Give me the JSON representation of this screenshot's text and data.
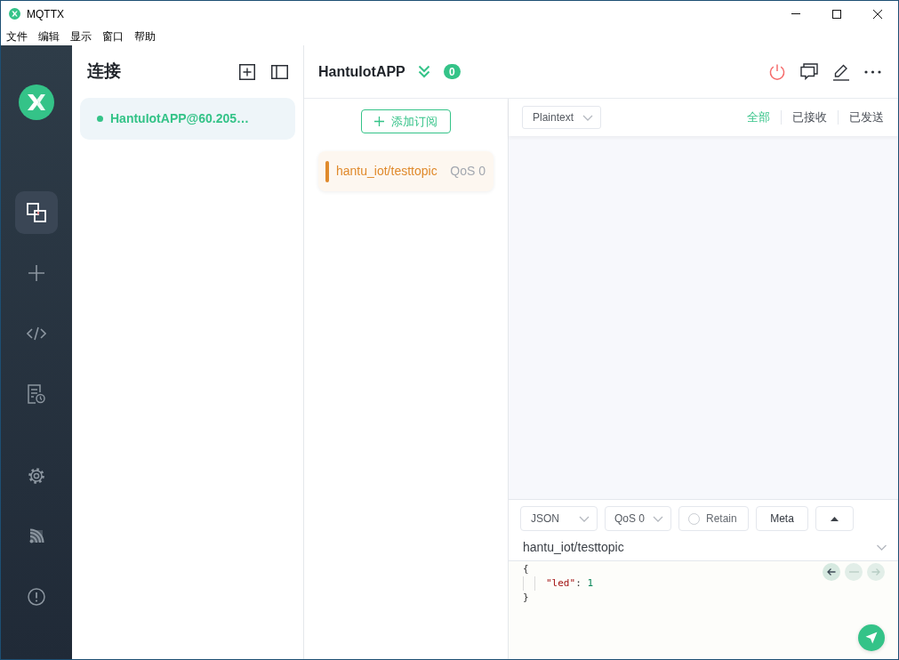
{
  "window": {
    "title": "MQTTX"
  },
  "menu_bar": [
    "文件",
    "编辑",
    "显示",
    "窗口",
    "帮助"
  ],
  "nav": {
    "top_items": [
      {
        "kind": "connections",
        "selected": true
      },
      {
        "kind": "new_connection",
        "selected": false
      },
      {
        "kind": "script",
        "selected": false
      },
      {
        "kind": "log",
        "selected": false
      }
    ],
    "bottom_items": [
      {
        "kind": "settings",
        "selected": false
      },
      {
        "kind": "feed",
        "selected": false
      },
      {
        "kind": "about",
        "selected": false
      }
    ]
  },
  "connections_panel": {
    "title": "连接",
    "items": [
      {
        "name": "HantuIotAPP@60.205…",
        "connected": true,
        "selected": true
      }
    ]
  },
  "connection_view": {
    "title": "HantuIotAPP",
    "unread_count": "0"
  },
  "subscriptions": {
    "add_button": "添加订阅",
    "items": [
      {
        "topic": "hantu_iot/testtopic",
        "qos": "QoS 0",
        "color": "#e08a2c"
      }
    ]
  },
  "messages": {
    "payload_format": "Plaintext",
    "filters": [
      {
        "label": "全部",
        "selected": true
      },
      {
        "label": "已接收",
        "selected": false
      },
      {
        "label": "已发送",
        "selected": false
      }
    ]
  },
  "publish": {
    "payload_format": "JSON",
    "qos": "QoS 0",
    "retain": {
      "label": "Retain",
      "checked": false
    },
    "meta_button": "Meta",
    "topic": "hantu_iot/testtopic",
    "payload_lines": [
      {
        "indented": false,
        "tokens": [
          {
            "kind": "punct",
            "text": "{"
          }
        ]
      },
      {
        "indented": true,
        "tokens": [
          {
            "kind": "key",
            "text": "\"led\""
          },
          {
            "kind": "punct",
            "text": ": "
          },
          {
            "kind": "number",
            "text": "1"
          }
        ]
      },
      {
        "indented": false,
        "tokens": [
          {
            "kind": "punct",
            "text": "}"
          }
        ]
      }
    ],
    "history_buttons": [
      {
        "kind": "back",
        "disabled": false
      },
      {
        "kind": "reset",
        "disabled": true
      },
      {
        "kind": "forward",
        "disabled": true
      }
    ]
  }
}
